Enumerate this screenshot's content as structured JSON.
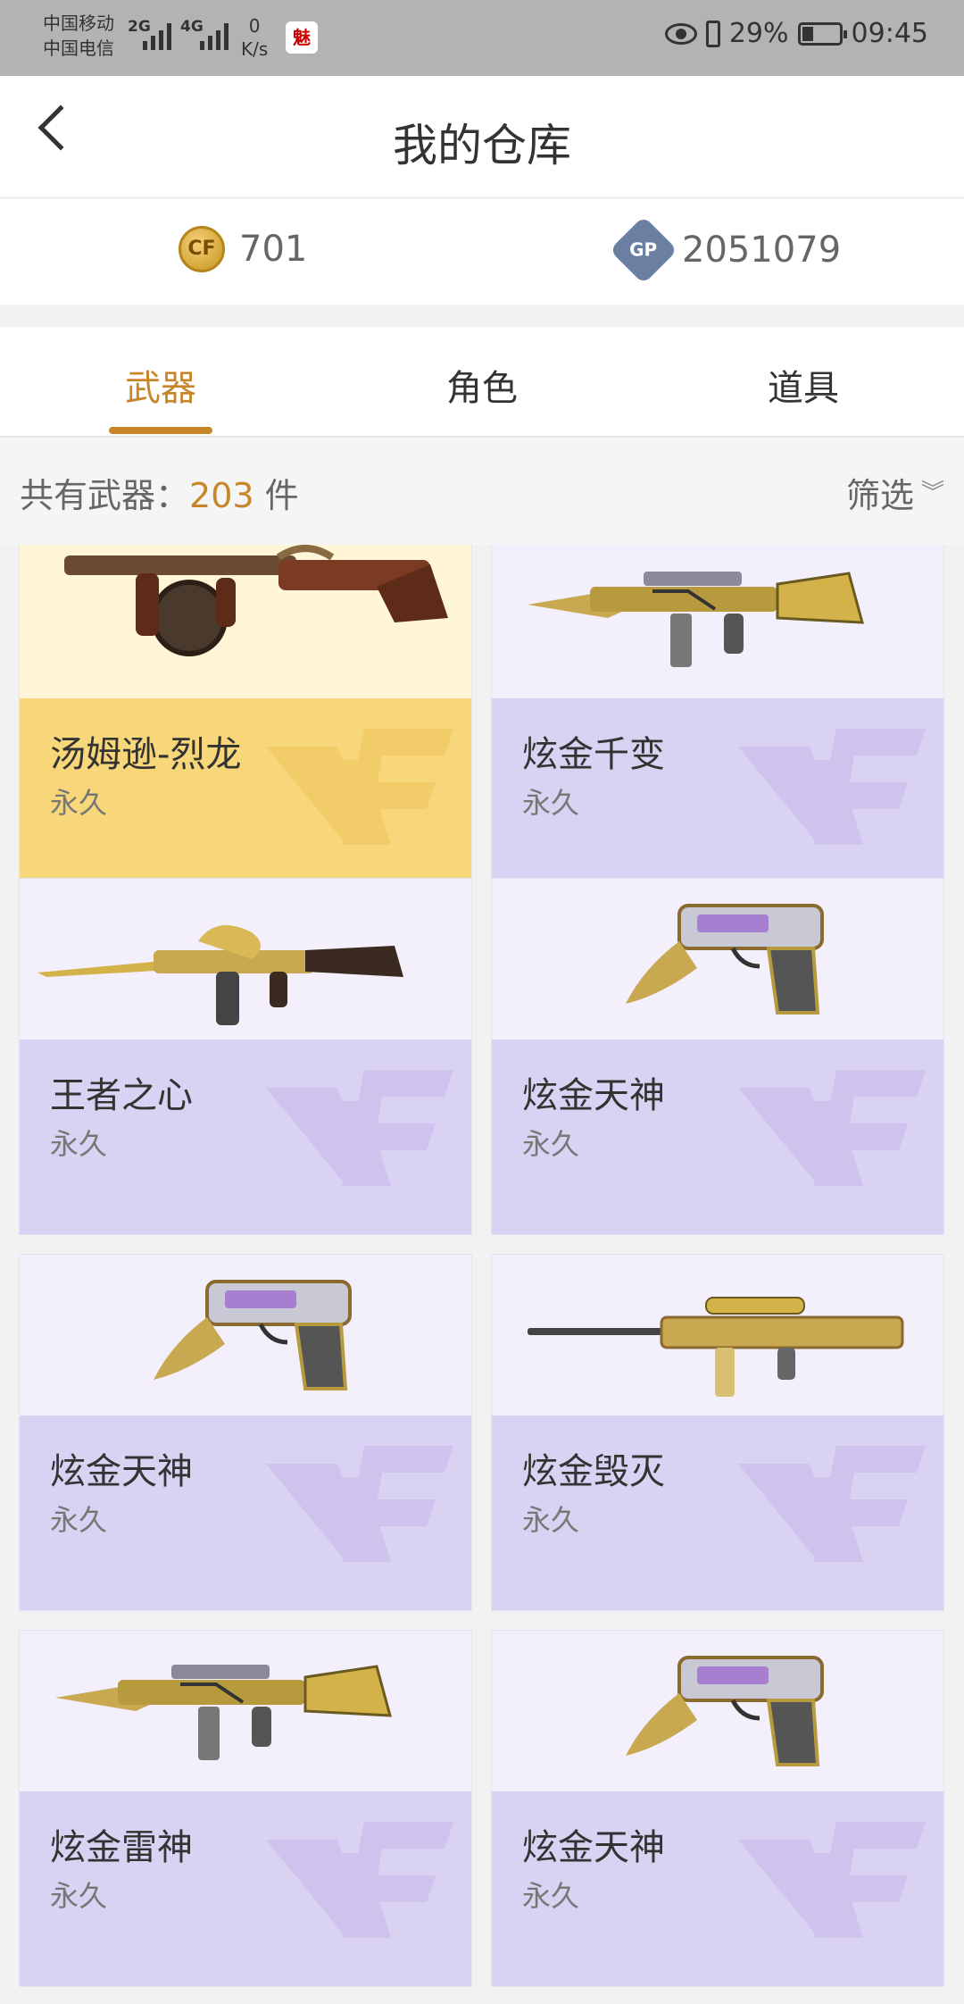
{
  "status_bar": {
    "carrier1": "中国移动",
    "carrier2": "中国电信",
    "net1": "2G",
    "net2": "4G",
    "speed_value": "0",
    "speed_unit": "K/s",
    "battery": "29%",
    "battery_level": 0.29,
    "time": "09:45"
  },
  "header": {
    "title": "我的仓库"
  },
  "currency": {
    "cf_icon": "cf-coin-icon",
    "cf_value": "701",
    "gp_icon": "gp-coin-icon",
    "gp_label": "GP",
    "gp_value": "2051079"
  },
  "tabs": [
    {
      "label": "武器",
      "active": true
    },
    {
      "label": "角色",
      "active": false
    },
    {
      "label": "道具",
      "active": false
    }
  ],
  "summary": {
    "prefix": "共有武器：",
    "count": "203",
    "suffix": " 件",
    "filter_label": "筛选"
  },
  "items": [
    {
      "name": "汤姆逊-烈龙",
      "duration": "永久",
      "style": "gold",
      "gun": "tommy-gun"
    },
    {
      "name": "炫金千变",
      "duration": "永久",
      "style": "purple",
      "gun": "rifle"
    },
    {
      "name": "王者之心",
      "duration": "永久",
      "style": "purple",
      "gun": "ak"
    },
    {
      "name": "炫金天神",
      "duration": "永久",
      "style": "purple",
      "gun": "pistol"
    },
    {
      "name": "炫金天神",
      "duration": "永久",
      "style": "purple",
      "gun": "pistol"
    },
    {
      "name": "炫金毁灭",
      "duration": "永久",
      "style": "purple",
      "gun": "sniper"
    },
    {
      "name": "炫金雷神",
      "duration": "永久",
      "style": "purple",
      "gun": "rifle"
    },
    {
      "name": "炫金天神",
      "duration": "永久",
      "style": "purple",
      "gun": "pistol"
    }
  ],
  "colors": {
    "accent": "#c7862a",
    "gold_card": "#f8d77a",
    "purple_card": "#d9d2f2"
  }
}
